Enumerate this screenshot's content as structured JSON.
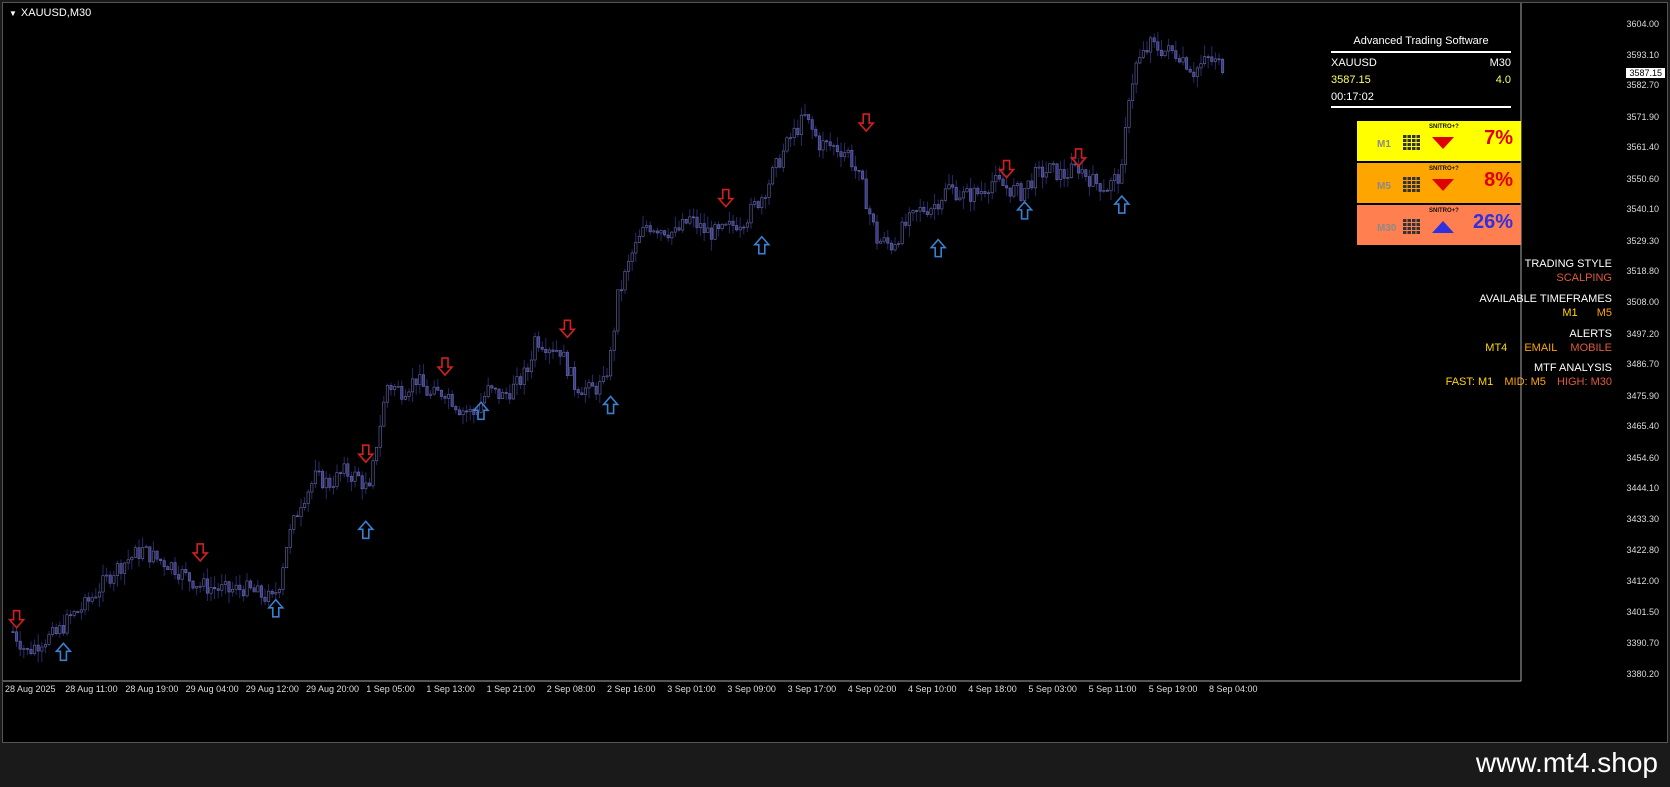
{
  "symbol": "XAUUSD,M30",
  "panel": {
    "title": "Advanced Trading Software",
    "pair": "XAUUSD",
    "timeframe": "M30",
    "price": "3587.15",
    "spread": "4.0",
    "timer": "00:17:02"
  },
  "signals": [
    {
      "tf": "M1",
      "label": "SNITRO+?",
      "pct": "7%",
      "dir": "down",
      "bg": "#ffff00",
      "pct_color": "#e00000",
      "arrow_color": "#e00000"
    },
    {
      "tf": "M5",
      "label": "SNITRO+?",
      "pct": "8%",
      "dir": "down",
      "bg": "#ffa500",
      "pct_color": "#e00000",
      "arrow_color": "#e00000"
    },
    {
      "tf": "M30",
      "label": "SNITRO+?",
      "pct": "26%",
      "dir": "up",
      "bg": "#ff7f50",
      "pct_color": "#3030e0",
      "arrow_color": "#3030e0"
    }
  ],
  "info": {
    "trading_style_label": "TRADING STYLE",
    "trading_style_value": "SCALPING",
    "timeframes_label": "AVAILABLE TIMEFRAMES",
    "timeframes_m1": "M1",
    "timeframes_m5": "M5",
    "alerts_label": "ALERTS",
    "alerts_mt4": "MT4",
    "alerts_email": "EMAIL",
    "alerts_mobile": "MOBILE",
    "mtf_label": "MTF ANALYSIS",
    "mtf_fast": "FAST: M1",
    "mtf_mid": "MID: M5",
    "mtf_high": "HIGH: M30"
  },
  "current_price_label": "3587.15",
  "watermark": "www.mt4.shop",
  "colors": {
    "candle": "#2a2a6a",
    "up_arrow": "#3a7fd0",
    "down_arrow": "#d02020"
  },
  "chart_data": {
    "type": "candlestick",
    "ylim": [
      3378,
      3608
    ],
    "y_ticks": [
      "3604.00",
      "3593.10",
      "3582.70",
      "3571.90",
      "3561.40",
      "3550.60",
      "3540.10",
      "3529.30",
      "3518.80",
      "3508.00",
      "3497.20",
      "3486.70",
      "3475.90",
      "3465.40",
      "3454.60",
      "3444.10",
      "3433.30",
      "3422.80",
      "3412.00",
      "3401.50",
      "3390.70",
      "3380.20"
    ],
    "x_ticks": [
      "28 Aug 2025",
      "28 Aug 11:00",
      "28 Aug 19:00",
      "29 Aug 04:00",
      "29 Aug 12:00",
      "29 Aug 20:00",
      "1 Sep 05:00",
      "1 Sep 13:00",
      "1 Sep 21:00",
      "2 Sep 08:00",
      "2 Sep 16:00",
      "3 Sep 01:00",
      "3 Sep 09:00",
      "3 Sep 17:00",
      "4 Sep 02:00",
      "4 Sep 10:00",
      "4 Sep 18:00",
      "5 Sep 03:00",
      "5 Sep 11:00",
      "5 Sep 19:00",
      "8 Sep 04:00"
    ],
    "path": [
      [
        0,
        3395
      ],
      [
        4,
        3388
      ],
      [
        8,
        3392
      ],
      [
        12,
        3394
      ],
      [
        16,
        3400
      ],
      [
        20,
        3404
      ],
      [
        24,
        3410
      ],
      [
        28,
        3416
      ],
      [
        32,
        3420
      ],
      [
        36,
        3423
      ],
      [
        40,
        3420
      ],
      [
        44,
        3418
      ],
      [
        48,
        3414
      ],
      [
        52,
        3411
      ],
      [
        56,
        3410
      ],
      [
        60,
        3409
      ],
      [
        64,
        3410
      ],
      [
        68,
        3408
      ],
      [
        72,
        3406
      ],
      [
        74,
        3412
      ],
      [
        76,
        3425
      ],
      [
        80,
        3440
      ],
      [
        84,
        3448
      ],
      [
        88,
        3446
      ],
      [
        92,
        3450
      ],
      [
        96,
        3448
      ],
      [
        99,
        3443
      ],
      [
        101,
        3460
      ],
      [
        104,
        3480
      ],
      [
        108,
        3478
      ],
      [
        112,
        3482
      ],
      [
        116,
        3476
      ],
      [
        120,
        3478
      ],
      [
        124,
        3472
      ],
      [
        128,
        3470
      ],
      [
        132,
        3478
      ],
      [
        136,
        3476
      ],
      [
        140,
        3480
      ],
      [
        143,
        3485
      ],
      [
        145,
        3496
      ],
      [
        148,
        3494
      ],
      [
        152,
        3492
      ],
      [
        156,
        3480
      ],
      [
        160,
        3478
      ],
      [
        164,
        3480
      ],
      [
        166,
        3490
      ],
      [
        168,
        3510
      ],
      [
        172,
        3525
      ],
      [
        176,
        3535
      ],
      [
        180,
        3534
      ],
      [
        184,
        3532
      ],
      [
        188,
        3537
      ],
      [
        192,
        3533
      ],
      [
        196,
        3532
      ],
      [
        200,
        3535
      ],
      [
        204,
        3538
      ],
      [
        208,
        3545
      ],
      [
        212,
        3555
      ],
      [
        216,
        3565
      ],
      [
        220,
        3572
      ],
      [
        224,
        3563
      ],
      [
        228,
        3562
      ],
      [
        232,
        3560
      ],
      [
        236,
        3548
      ],
      [
        240,
        3530
      ],
      [
        244,
        3528
      ],
      [
        248,
        3535
      ],
      [
        252,
        3540
      ],
      [
        256,
        3542
      ],
      [
        260,
        3548
      ],
      [
        264,
        3545
      ],
      [
        268,
        3546
      ],
      [
        272,
        3550
      ],
      [
        276,
        3548
      ],
      [
        280,
        3546
      ],
      [
        284,
        3552
      ],
      [
        288,
        3554
      ],
      [
        292,
        3552
      ],
      [
        296,
        3555
      ],
      [
        300,
        3550
      ],
      [
        304,
        3548
      ],
      [
        308,
        3553
      ],
      [
        310,
        3580
      ],
      [
        312,
        3590
      ],
      [
        316,
        3597
      ],
      [
        320,
        3595
      ],
      [
        324,
        3594
      ],
      [
        328,
        3588
      ],
      [
        332,
        3592
      ],
      [
        336,
        3590
      ]
    ],
    "up_arrows": [
      [
        14,
        3392
      ],
      [
        73,
        3407
      ],
      [
        98,
        3434
      ],
      [
        130,
        3475
      ],
      [
        166,
        3477
      ],
      [
        208,
        3532
      ],
      [
        257,
        3531
      ],
      [
        281,
        3544
      ],
      [
        308,
        3546
      ]
    ],
    "down_arrows": [
      [
        1,
        3396
      ],
      [
        52,
        3419
      ],
      [
        98,
        3453
      ],
      [
        120,
        3483
      ],
      [
        154,
        3496
      ],
      [
        198,
        3541
      ],
      [
        237,
        3567
      ],
      [
        276,
        3551
      ],
      [
        296,
        3555
      ]
    ]
  }
}
